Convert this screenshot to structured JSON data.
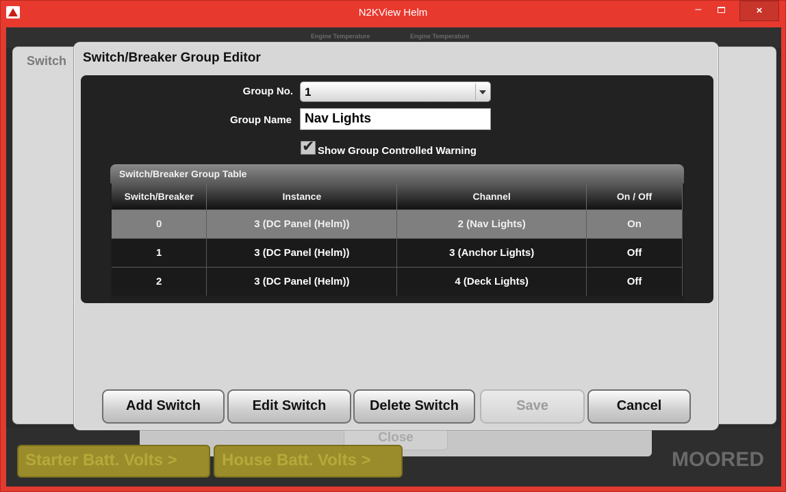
{
  "window": {
    "title": "N2KView Helm",
    "minimize": "–",
    "close": "×"
  },
  "background": {
    "panel_title": "Switch",
    "ghost_1": "Engine Temperature",
    "ghost_2": "Engine Temperature",
    "close_label": "Close",
    "tile_1": "Starter Batt. Volts >",
    "tile_2": "House Batt. Volts >",
    "status": "MOORED"
  },
  "dialog": {
    "title": "Switch/Breaker Group Editor",
    "group_no_label": "Group No.",
    "group_no_value": "1",
    "group_name_label": "Group Name",
    "group_name_value": "Nav Lights",
    "warning_label": "Show Group Controlled Warning",
    "warning_checked": true,
    "table": {
      "title": "Switch/Breaker Group Table",
      "headers": [
        "Switch/Breaker",
        "Instance",
        "Channel",
        "On / Off"
      ],
      "rows": [
        [
          "0",
          "3 (DC Panel (Helm))",
          "2 (Nav Lights)",
          "On"
        ],
        [
          "1",
          "3 (DC Panel (Helm))",
          "3 (Anchor Lights)",
          "Off"
        ],
        [
          "2",
          "3 (DC Panel (Helm))",
          "4 (Deck Lights)",
          "Off"
        ]
      ],
      "selected_row": 0
    },
    "buttons": {
      "add": "Add Switch",
      "edit": "Edit Switch",
      "delete": "Delete Switch",
      "save": "Save",
      "cancel": "Cancel"
    }
  }
}
